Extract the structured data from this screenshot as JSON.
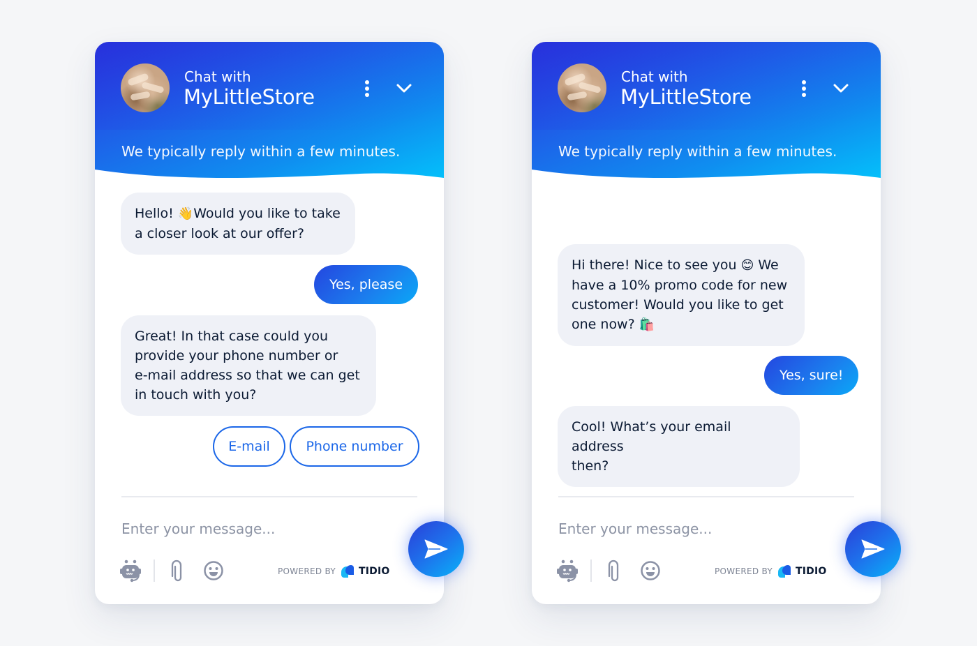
{
  "widgets": [
    {
      "header": {
        "chat_with": "Chat with",
        "store_name": "MyLittleStore",
        "reply_time": "We typically reply within a few minutes.",
        "menu_icon": "more-vertical-icon",
        "collapse_icon": "chevron-down-icon"
      },
      "messages": [
        {
          "from": "bot",
          "line1": "Hello! ",
          "emoji": "👋",
          "line1b": "Would you like to take",
          "line2": "a closer look at our offer?"
        },
        {
          "from": "user",
          "text": "Yes, please"
        },
        {
          "from": "bot",
          "lines": [
            "Great! In that case could you",
            "provide your phone number or",
            "e-mail address so that we can get",
            "in touch with you?"
          ]
        }
      ],
      "quick_replies": [
        "E-mail",
        "Phone number"
      ],
      "input": {
        "placeholder": "Enter your message...",
        "value": ""
      },
      "footer": {
        "powered_by": "POWERED BY",
        "brand": "TIDIO",
        "icons": [
          "bot-icon",
          "paperclip-icon",
          "emoji-icon"
        ],
        "send_icon": "send-icon"
      }
    },
    {
      "header": {
        "chat_with": "Chat with",
        "store_name": "MyLittleStore",
        "reply_time": "We typically reply within a few minutes.",
        "menu_icon": "more-vertical-icon",
        "collapse_icon": "chevron-down-icon"
      },
      "messages": [
        {
          "from": "bot",
          "l1a": "Hi there! Nice to see you ",
          "e1": "😊",
          "l1b": " We",
          "l2": "have a 10% promo code for new",
          "l3": "customer! Would you like to get",
          "l4": "one now? ",
          "e2": "🛍️"
        },
        {
          "from": "user",
          "text": "Yes, sure!"
        },
        {
          "from": "bot",
          "lines": [
            "Cool! What’s your email address",
            "then?"
          ]
        }
      ],
      "input": {
        "placeholder": "Enter your message...",
        "value": ""
      },
      "footer": {
        "powered_by": "POWERED BY",
        "brand": "TIDIO",
        "icons": [
          "bot-icon",
          "paperclip-icon",
          "emoji-icon"
        ],
        "send_icon": "send-icon"
      }
    }
  ],
  "colors": {
    "accent": "#1a66e8",
    "header_gradient_start": "#2833dc",
    "header_gradient_end": "#03c4fb",
    "bot_bubble": "#eff1f7",
    "text_dark": "#0b1a33",
    "placeholder": "#8c93a4",
    "page_background": "#f5f6f8"
  }
}
